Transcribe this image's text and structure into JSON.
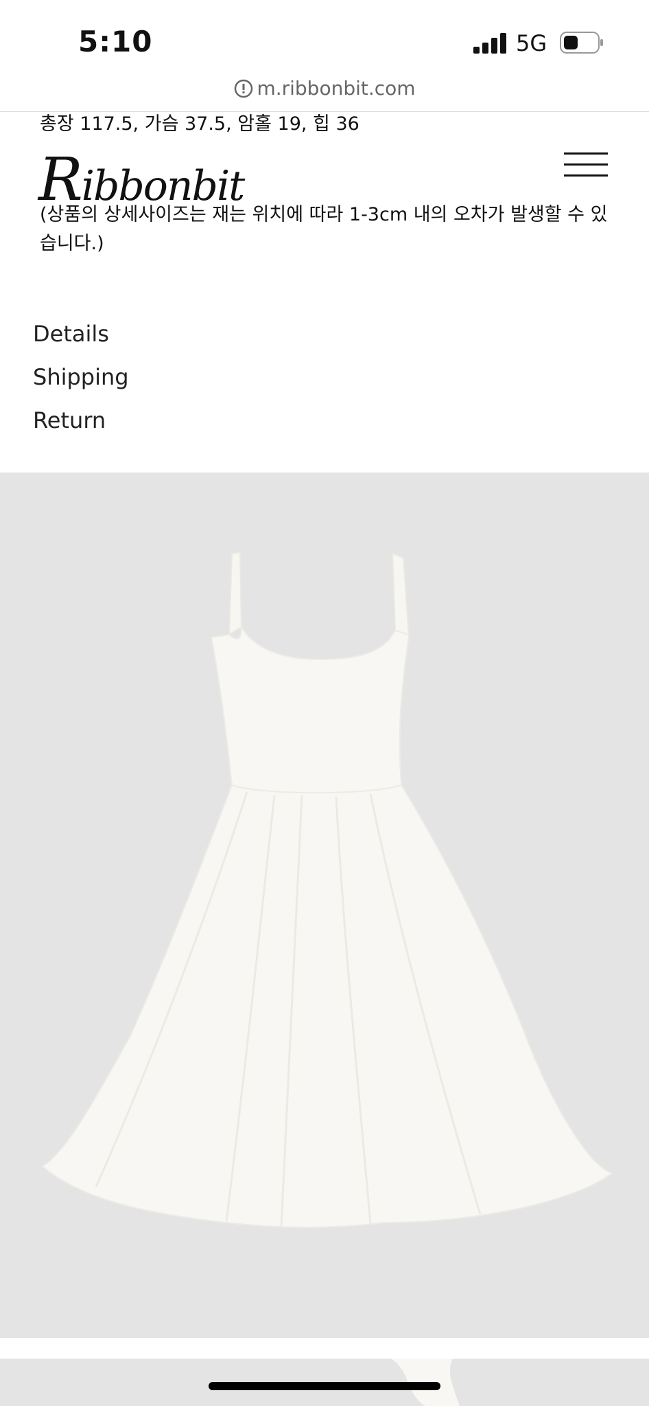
{
  "status": {
    "time": "5:10",
    "network": "5G",
    "signal_icon": "cellular-signal-icon",
    "battery_icon": "battery-icon"
  },
  "browser": {
    "url": "m.ribbonbit.com",
    "info_icon": "info-circle-icon"
  },
  "product": {
    "size_line": "총장 117.5, 가슴 37.5, 암홀 19, 힙 36",
    "size_note": "(상품의 상세사이즈는 재는 위치에 따라 1-3cm 내의 오차가 발생할 수 있습니다.)"
  },
  "brand": {
    "logo_text": "Ribbonbit",
    "logo_cap": "R",
    "logo_rest": "ibbonbit"
  },
  "tabs": [
    {
      "label": "Details"
    },
    {
      "label": "Shipping"
    },
    {
      "label": "Return"
    }
  ],
  "colors": {
    "image_background": "#e4e4e4",
    "dress": "#f7f6f1",
    "url_text": "#666666"
  }
}
